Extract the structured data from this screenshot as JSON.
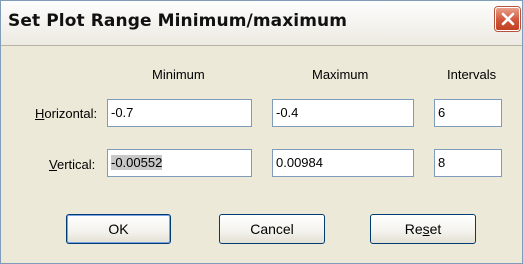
{
  "window": {
    "title": "Set Plot Range Minimum/maximum"
  },
  "columns": {
    "minimum": "Minimum",
    "maximum": "Maximum",
    "intervals": "Intervals"
  },
  "horizontal": {
    "label_hotkey": "H",
    "label_rest": "orizontal:",
    "minimum": "-0.7",
    "maximum": "-0.4",
    "intervals": "6"
  },
  "vertical": {
    "label_hotkey": "V",
    "label_rest": "ertical:",
    "minimum": "-0.00552",
    "maximum": "0.00984",
    "intervals": "8"
  },
  "buttons": {
    "ok": "OK",
    "cancel": "Cancel",
    "reset_pre": "Re",
    "reset_hotkey": "s",
    "reset_post": "et"
  },
  "icons": {
    "close": "close-icon"
  },
  "colors": {
    "close_button": "#d0553a",
    "field_border": "#7f9db9",
    "dialog_bg": "#ece9d8"
  }
}
